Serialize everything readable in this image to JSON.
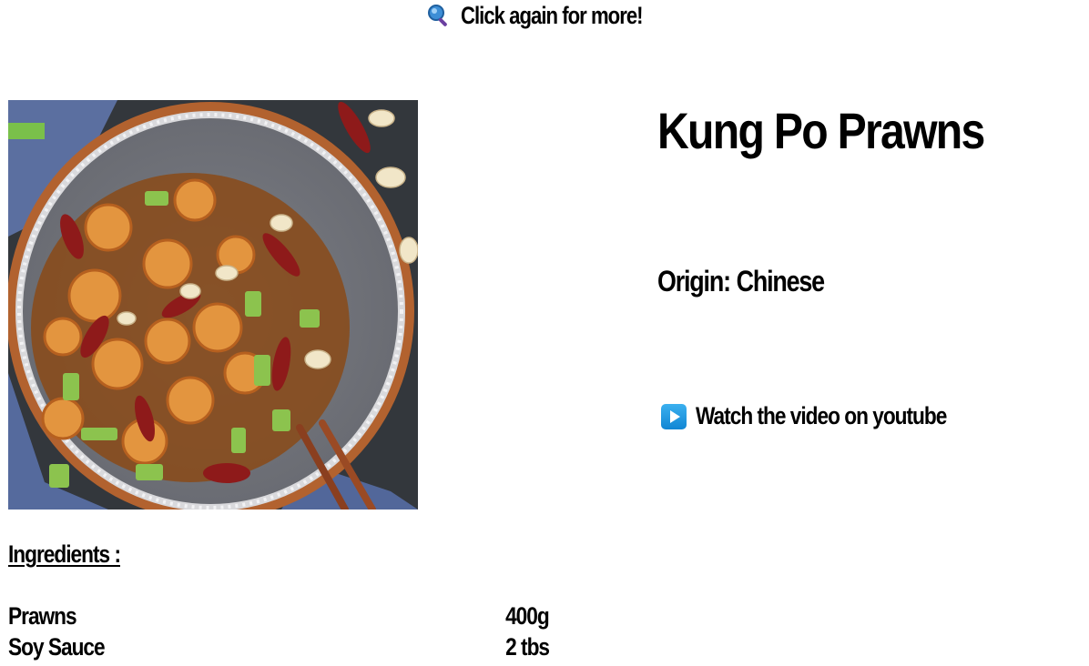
{
  "header": {
    "refresh_label": "Click again for more!",
    "refresh_icon": "magnifier-icon"
  },
  "recipe": {
    "title": "Kung Po Prawns",
    "origin_label": "Origin:",
    "origin_value": "Chinese",
    "video_label": "Watch the video on youtube",
    "video_icon": "play-button-icon",
    "image_alt": "Kung Po Prawns"
  },
  "ingredients": {
    "heading": "Ingredients :",
    "items": [
      {
        "name": "Prawns",
        "quantity": "400g"
      },
      {
        "name": "Soy Sauce",
        "quantity": "2 tbs"
      }
    ]
  },
  "colors": {
    "play_icon": "#1a9be8",
    "text": "#000000",
    "background": "#ffffff"
  }
}
